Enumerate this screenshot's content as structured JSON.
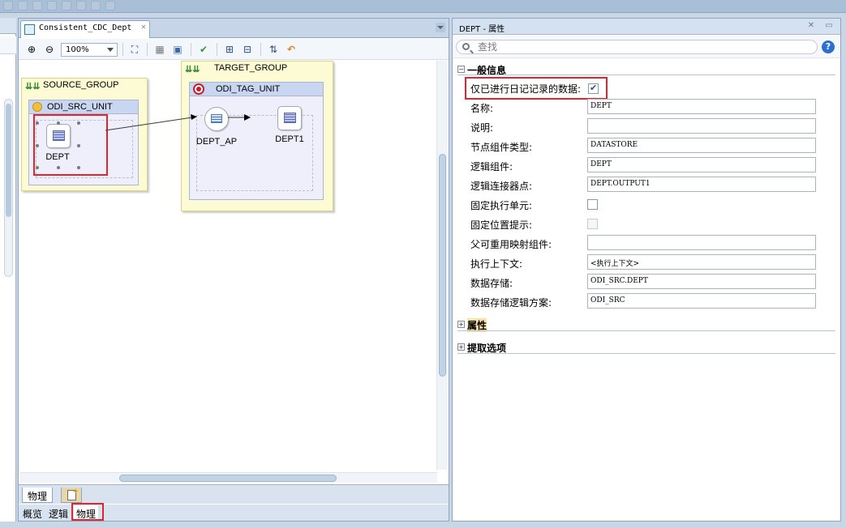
{
  "editor": {
    "tab_title": "Consistent_CDC_Dept",
    "zoom": "100%"
  },
  "diagram": {
    "source_group": {
      "title": "SOURCE_GROUP",
      "unit_title": "ODI_SRC_UNIT",
      "node_label": "DEPT"
    },
    "target_group": {
      "title": "TARGET_GROUP",
      "unit_title": "ODI_TAG_UNIT",
      "node1_label": "DEPT_AP",
      "node2_label": "DEPT1"
    }
  },
  "bottom_tabs": {
    "primary": [
      "物理"
    ],
    "secondary": [
      "概览",
      "逻辑",
      "物理"
    ]
  },
  "properties": {
    "title": "DEPT - 属性",
    "search_placeholder": "查找",
    "sections": {
      "general": "一般信息",
      "attributes": "属性",
      "extract": "提取选项"
    },
    "journalized_label": "仅已进行日记记录的数据:",
    "journalized_checked": true,
    "rows": [
      {
        "label": "名称:",
        "value": "DEPT"
      },
      {
        "label": "说明:",
        "value": ""
      },
      {
        "label": "节点组件类型:",
        "value": "DATASTORE"
      },
      {
        "label": "逻辑组件:",
        "value": "DEPT"
      },
      {
        "label": "逻辑连接器点:",
        "value": "DEPT.OUTPUT1"
      },
      {
        "label": "固定执行单元:",
        "value": null
      },
      {
        "label": "固定位置提示:",
        "value": null
      },
      {
        "label": "父可重用映射组件:",
        "value": ""
      },
      {
        "label": "执行上下文:",
        "value": "<执行上下文>"
      },
      {
        "label": "数据存储:",
        "value": "ODI_SRC.DEPT"
      },
      {
        "label": "数据存储逻辑方案:",
        "value": "ODI_SRC"
      }
    ]
  },
  "colors": {
    "highlight": "#e0262d",
    "group_bg": "#fcfbd3",
    "unit_header": "#c9d6f2"
  }
}
